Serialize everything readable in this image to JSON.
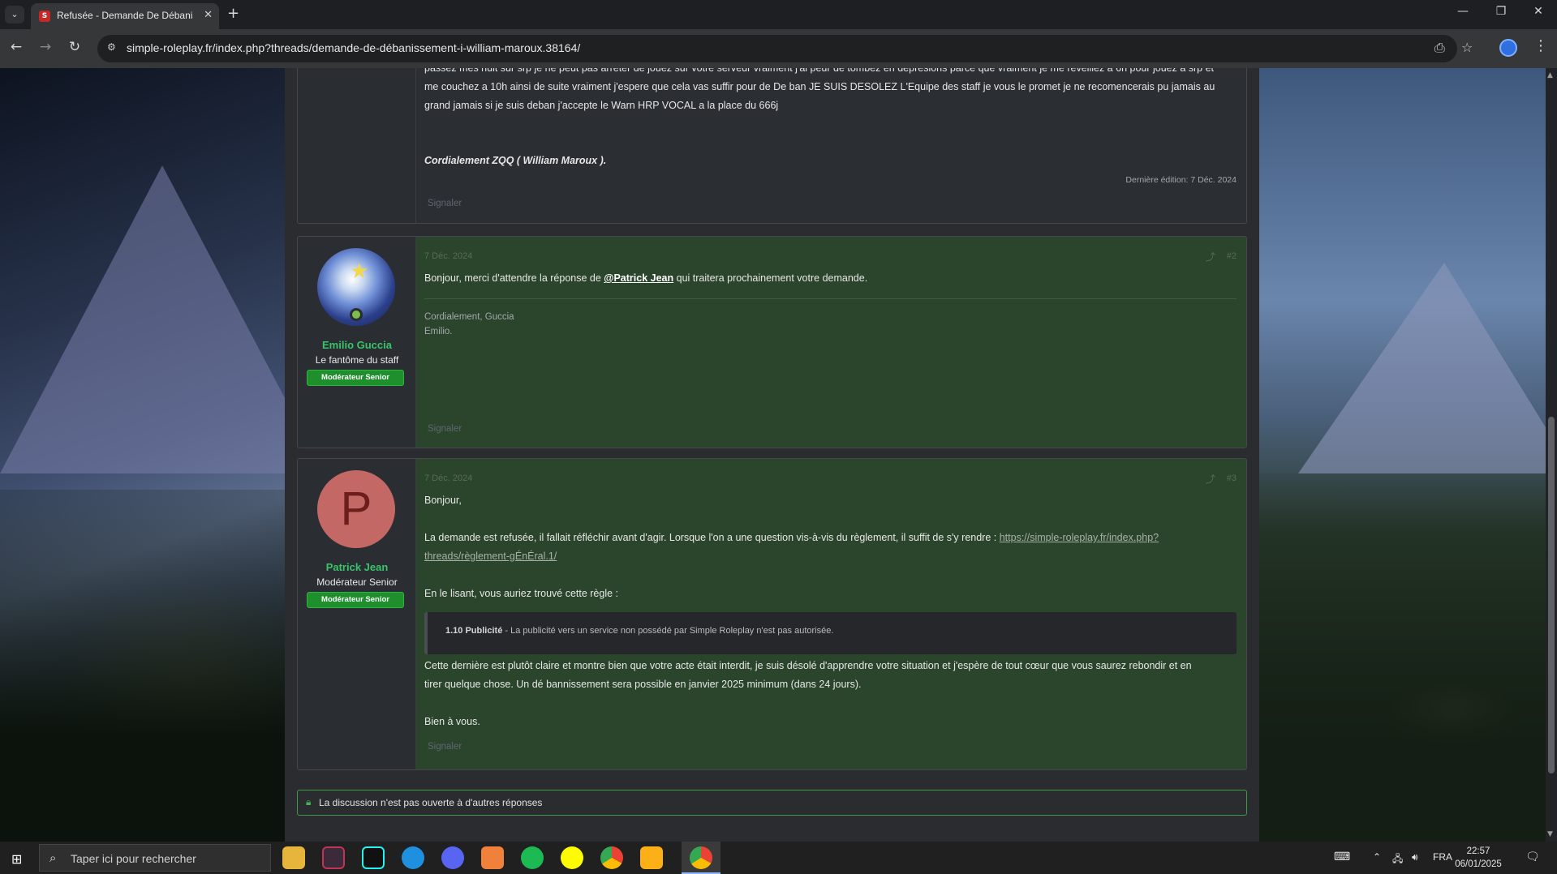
{
  "browser": {
    "tab_title": "Refusée - Demande De Débanissement",
    "url": "simple-roleplay.fr/index.php?threads/demande-de-débanissement-i-william-maroux.38164/"
  },
  "post1": {
    "lines": [
      "passez mes nuit sur srp je ne peut pas arreter de jouez sur votre serveur vraiment j'ai peur de tombez en depresions parce que vraiment je me reveillez a 6h pour jouez a srp et",
      "me couchez a 10h ainsi de suite vraiment j'espere que cela vas suffir pour de De ban JE SUIS DESOLEZ L'Equipe des staff je vous le promet je ne recomencerais pu jamais au",
      "grand jamais si je suis deban j'accepte le Warn HRP VOCAL a la place du 666j"
    ],
    "signature": "Cordialement ZQQ ( William Maroux ).",
    "last_edit": "Dernière édition: 7 Déc. 2024",
    "report": "Signaler"
  },
  "post2": {
    "date": "7 Déc. 2024",
    "number": "#2",
    "author": "Emilio Guccia",
    "author_title": "Le fantôme du staff",
    "badge": "Modérateur Senior",
    "text_before": "Bonjour, merci d'attendre la réponse de ",
    "mention": "@Patrick Jean",
    "text_after": " qui traitera prochainement votre demande.",
    "sig_line1": "Cordialement, Guccia",
    "sig_line2": "Emilio.",
    "report": "Signaler"
  },
  "post3": {
    "date": "7 Déc. 2024",
    "number": "#3",
    "avatar_letter": "P",
    "author": "Patrick Jean",
    "author_title": "Modérateur Senior",
    "badge": "Modérateur Senior",
    "greeting": "Bonjour,",
    "para1": "La demande est refusée, il fallait réfléchir avant d'agir. Lorsque l'on a une question vis-à-vis du règlement, il suffit de s'y rendre : ",
    "link_part1": "https://simple-roleplay.fr/index.php?",
    "link_part2": "threads/règlement-gÉnÉral.1/",
    "para2": "En le lisant, vous auriez trouvé cette règle :",
    "rule_title": "1.10 Publicité",
    "rule_text": " - La publicité vers un service non possédé par Simple Roleplay n'est pas autorisée.",
    "para3_line1": "Cette dernière est plutôt claire et montre bien que votre acte était interdit, je suis désolé d'apprendre votre situation et j'espère de tout cœur que vous saurez rebondir et en",
    "para3_line2": "tirer quelque chose. Un dé bannissement sera possible en janvier 2025 minimum (dans 24 jours).",
    "closing": "Bien à vous.",
    "report": "Signaler"
  },
  "thread_closed": "La discussion n'est pas ouverte à d'autres réponses",
  "taskbar": {
    "search_placeholder": "Taper ici pour rechercher",
    "language": "FRA",
    "time": "22:57",
    "date": "06/01/2025"
  }
}
